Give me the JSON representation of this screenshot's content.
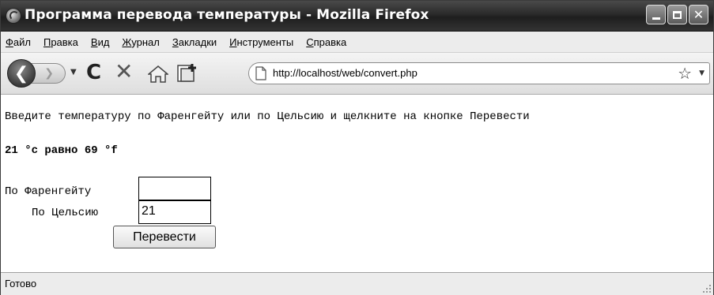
{
  "window": {
    "title": "Программа перевода температуры - Mozilla Firefox",
    "buttons": {
      "minimize": "_",
      "maximize": "□",
      "close": "✕"
    }
  },
  "menubar": {
    "items": [
      {
        "accel": "Ф",
        "rest": "айл"
      },
      {
        "accel": "П",
        "rest": "равка"
      },
      {
        "accel": "В",
        "rest": "ид"
      },
      {
        "accel": "Ж",
        "rest": "урнал"
      },
      {
        "accel": "З",
        "rest": "акладки"
      },
      {
        "accel": "И",
        "rest": "нструменты"
      },
      {
        "accel": "С",
        "rest": "правка"
      }
    ]
  },
  "toolbar": {
    "icons": [
      "back-icon",
      "forward-icon",
      "history-dropdown-icon",
      "reload-icon",
      "stop-icon",
      "home-icon",
      "bookmark-add-icon"
    ],
    "back_glyph": "❮",
    "forward_glyph": "❯",
    "history_glyph": "▼",
    "reload_glyph": "C",
    "stop_glyph": "✕",
    "url": "http://localhost/web/convert.php",
    "star_glyph": "☆",
    "dropdown_glyph": "▼"
  },
  "page": {
    "instruction": "Введите температуру по Фаренгейту или по Цельсию и щелкните на кнопке Перевести",
    "result": "21 °c равно 69 °f",
    "fahrenheit_label": "По Фаренгейту",
    "celsius_label": "По Цельсию",
    "fahrenheit_value": "",
    "celsius_value": "21",
    "convert_button": "Перевести"
  },
  "statusbar": {
    "text": "Готово"
  },
  "colors": {
    "titlebar": "#2a2a2a",
    "chrome": "#ececec",
    "content_bg": "#ffffff"
  }
}
